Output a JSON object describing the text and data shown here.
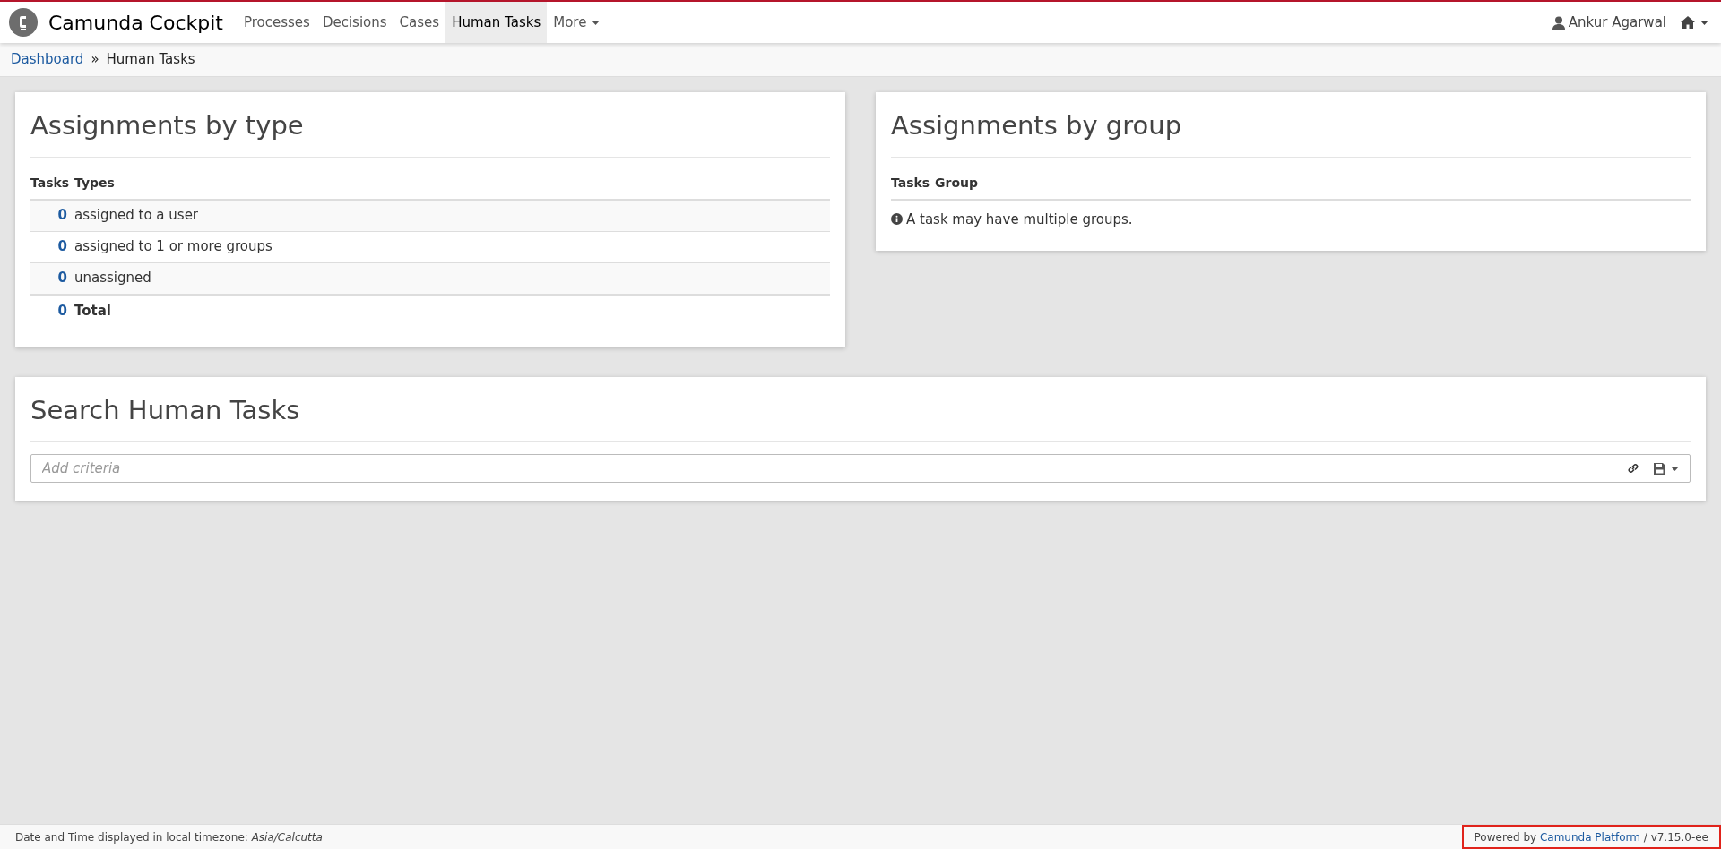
{
  "header": {
    "brand": "Camunda Cockpit",
    "nav": [
      {
        "label": "Processes",
        "selected": false
      },
      {
        "label": "Decisions",
        "selected": false
      },
      {
        "label": "Cases",
        "selected": false
      },
      {
        "label": "Human Tasks",
        "selected": true
      },
      {
        "label": "More",
        "selected": false,
        "dropdown": true
      }
    ],
    "user": "Ankur Agarwal"
  },
  "breadcrumb": [
    {
      "label": "Dashboard",
      "link": true
    },
    {
      "label": "»",
      "link": false
    },
    {
      "label": "Human Tasks",
      "link": false
    }
  ],
  "by_type": {
    "title": "Assignments by type",
    "columns": [
      "Tasks",
      "Types"
    ],
    "rows": [
      {
        "count": "0",
        "label": "assigned to a user",
        "total": false
      },
      {
        "count": "0",
        "label": "assigned to 1 or more groups",
        "total": false
      },
      {
        "count": "0",
        "label": "unassigned",
        "total": false
      },
      {
        "count": "0",
        "label": "Total",
        "total": true
      }
    ]
  },
  "by_group": {
    "title": "Assignments by group",
    "columns": [
      "Tasks",
      "Group"
    ],
    "note": "A task may have multiple groups."
  },
  "search": {
    "title": "Search Human Tasks",
    "placeholder": "Add criteria"
  },
  "footer": {
    "timezone": "Date and Time displayed in local timezone: *Asia/Calcutta*",
    "powered_prefix": "Powered by",
    "powered_link": "Camunda Platform",
    "version": "/ v7.15.0-ee"
  }
}
